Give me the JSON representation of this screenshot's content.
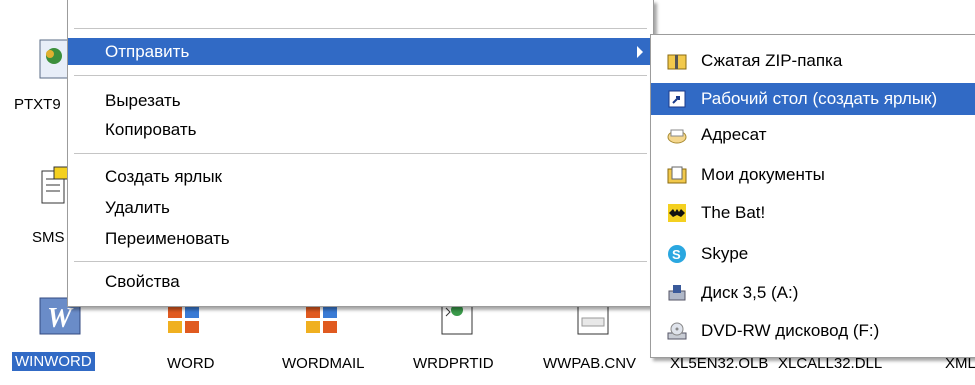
{
  "desktop": {
    "left_icons": [
      {
        "label": "PTXT9"
      },
      {
        "label": "SMS"
      }
    ],
    "bottom_icons": [
      {
        "label": "WINWORD",
        "selected": true
      },
      {
        "label": "WORD"
      },
      {
        "label": "WORDMAIL"
      },
      {
        "label": "WRDPRTID"
      },
      {
        "label": "WWPAB.CNV"
      },
      {
        "label": "XL5EN32.OLB"
      },
      {
        "label": "XLCALL32.DLL"
      },
      {
        "label": "XML"
      }
    ]
  },
  "context_menu": {
    "items": [
      {
        "label": "Отправить",
        "has_submenu": true,
        "highlighted": true
      },
      {
        "label": "Вырезать"
      },
      {
        "label": "Копировать"
      },
      {
        "label": "Создать ярлык"
      },
      {
        "label": "Удалить"
      },
      {
        "label": "Переименовать"
      },
      {
        "label": "Свойства"
      }
    ]
  },
  "send_to_submenu": {
    "items": [
      {
        "label": "Сжатая ZIP-папка",
        "icon": "zip-folder-icon"
      },
      {
        "label": "Рабочий стол (создать ярлык)",
        "icon": "desktop-shortcut-icon",
        "highlighted": true
      },
      {
        "label": "Адресат",
        "icon": "mail-recipient-icon"
      },
      {
        "label": "Мои документы",
        "icon": "my-documents-icon"
      },
      {
        "label": "The Bat!",
        "icon": "the-bat-icon"
      },
      {
        "label": "Skype",
        "icon": "skype-icon"
      },
      {
        "label": "Диск 3,5 (A:)",
        "icon": "floppy-drive-icon"
      },
      {
        "label": "DVD-RW дисковод (F:)",
        "icon": "dvd-drive-icon"
      }
    ]
  },
  "colors": {
    "highlight": "#316ac5",
    "menu_border": "#9c9c9c"
  }
}
